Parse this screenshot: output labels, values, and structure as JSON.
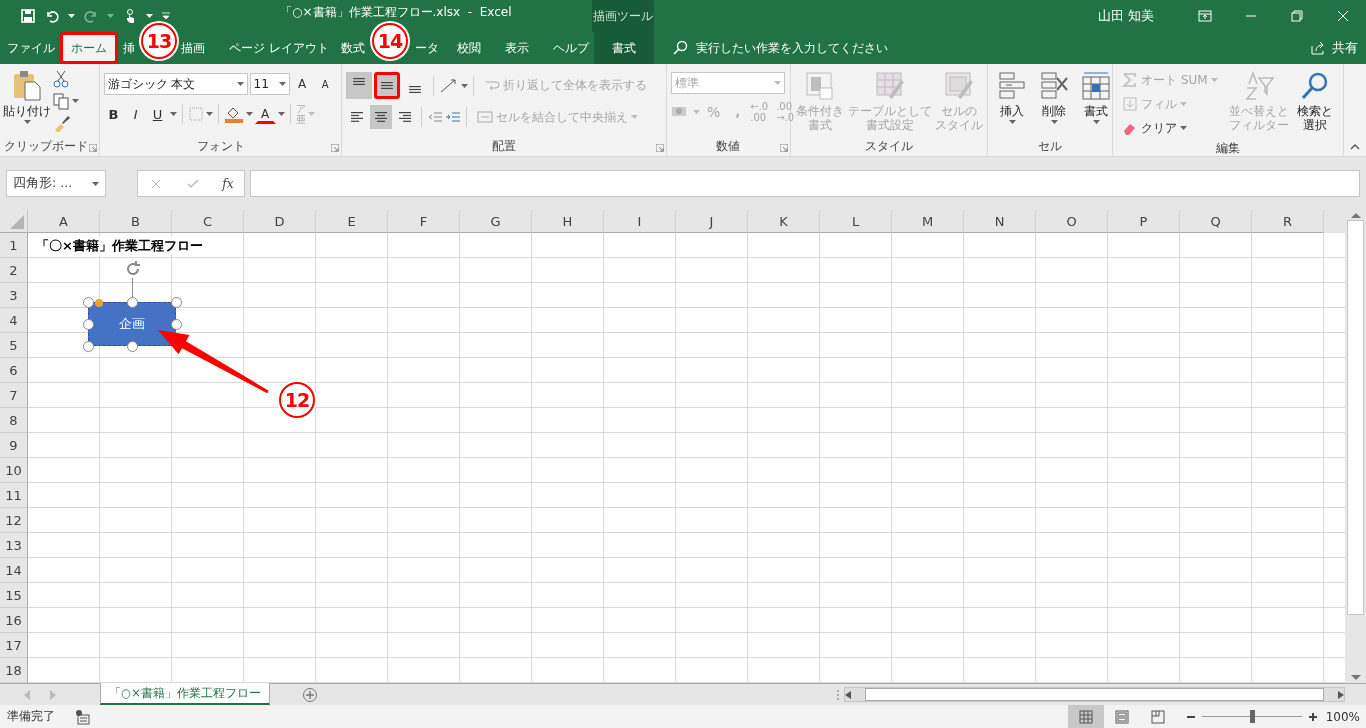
{
  "title_bar": {
    "title": "「○×書籍」作業工程フロー.xlsx  -  Excel",
    "context_group": "描画ツール",
    "user": "山田 知美"
  },
  "tabs": [
    {
      "label": "ファイル",
      "selected": false,
      "highlighted": false,
      "kind": "normal"
    },
    {
      "label": "ホーム",
      "selected": true,
      "highlighted": true,
      "kind": "normal"
    },
    {
      "label": "挿",
      "selected": false,
      "highlighted": false,
      "kind": "normal"
    },
    {
      "label": "描画",
      "selected": false,
      "highlighted": false,
      "kind": "normal"
    },
    {
      "label": "ページ レイアウト",
      "selected": false,
      "highlighted": false,
      "kind": "normal"
    },
    {
      "label": "数式",
      "selected": false,
      "highlighted": false,
      "kind": "normal"
    },
    {
      "label": "ータ",
      "selected": false,
      "highlighted": false,
      "kind": "normal"
    },
    {
      "label": "校閲",
      "selected": false,
      "highlighted": false,
      "kind": "normal"
    },
    {
      "label": "表示",
      "selected": false,
      "highlighted": false,
      "kind": "normal"
    },
    {
      "label": "ヘルプ",
      "selected": false,
      "highlighted": false,
      "kind": "normal"
    },
    {
      "label": "書式",
      "selected": false,
      "highlighted": false,
      "kind": "contextual"
    }
  ],
  "tell_me": {
    "placeholder": "実行したい作業を入力してください"
  },
  "share": "共有",
  "ribbon": {
    "clipboard": {
      "label": "クリップボード",
      "paste": "貼り付け"
    },
    "font": {
      "label": "フォント",
      "font_name": "游ゴシック 本文",
      "font_size": "11",
      "grow": "A",
      "shrink": "A",
      "styles": [
        "B",
        "I",
        "U"
      ],
      "fill": {
        "color": "#ed7d31"
      },
      "font_color": {
        "label": "A",
        "color": "#ff0000"
      },
      "phonetic": [
        "ア",
        "亜"
      ]
    },
    "alignment": {
      "label": "配置",
      "vertical": [
        {
          "kind": "top",
          "selected": true,
          "highlighted": false
        },
        {
          "kind": "middle",
          "selected": true,
          "highlighted": true
        },
        {
          "kind": "bottom",
          "selected": false,
          "highlighted": false
        }
      ],
      "horizontal": [
        {
          "kind": "left",
          "selected": false
        },
        {
          "kind": "center",
          "selected": true
        },
        {
          "kind": "right",
          "selected": false
        }
      ],
      "wrap": {
        "label": "折り返して全体を表示する",
        "disabled": true
      },
      "merge": {
        "label": "セルを結合して中央揃え",
        "disabled": true
      }
    },
    "number": {
      "label": "数値",
      "format": "標準",
      "percent": "%",
      "comma": ",",
      "increase_decimal": [
        "←.0",
        ".00"
      ],
      "decrease_decimal": [
        ".00",
        "→.0"
      ]
    },
    "styles": {
      "label": "スタイル",
      "buttons": [
        {
          "kind": "conditional",
          "lines": [
            "条件付き",
            "書式"
          ],
          "disabled": true
        },
        {
          "kind": "table",
          "lines": [
            "テーブルとして",
            "書式設定"
          ],
          "disabled": true
        },
        {
          "kind": "cellstyle",
          "lines": [
            "セルの",
            "スタイル"
          ],
          "disabled": true
        }
      ]
    },
    "cells": {
      "label": "セル",
      "buttons": [
        {
          "kind": "insert",
          "lines": [
            "挿入"
          ],
          "disabled": false
        },
        {
          "kind": "delete",
          "lines": [
            "削除"
          ],
          "disabled": false
        },
        {
          "kind": "format",
          "lines": [
            "書式"
          ],
          "disabled": false
        }
      ]
    },
    "editing": {
      "label": "編集",
      "small": [
        {
          "kind": "sum",
          "label": "オート SUM",
          "disabled": true
        },
        {
          "kind": "fill",
          "label": "フィル",
          "disabled": true
        },
        {
          "kind": "clear",
          "label": "クリア",
          "disabled": false
        }
      ],
      "buttons": [
        {
          "kind": "sort",
          "lines": [
            "並べ替えと",
            "フィルター"
          ],
          "disabled": true
        },
        {
          "kind": "find",
          "lines": [
            "検索と",
            "選択"
          ],
          "disabled": false
        }
      ]
    }
  },
  "formula_bar": {
    "name_box": "四角形: ...",
    "function_label": "fx"
  },
  "sheet": {
    "columns": [
      "A",
      "B",
      "C",
      "D",
      "E",
      "F",
      "G",
      "H",
      "I",
      "J",
      "K",
      "L",
      "M",
      "N",
      "O",
      "P",
      "Q",
      "R"
    ],
    "rows": [
      {
        "label": "1",
        "text": "「〇×書籍」作業工程フロー"
      },
      {
        "label": "2"
      },
      {
        "label": "3"
      },
      {
        "label": "4"
      },
      {
        "label": "5"
      },
      {
        "label": "6"
      },
      {
        "label": "7"
      },
      {
        "label": "8"
      },
      {
        "label": "9"
      },
      {
        "label": "10"
      },
      {
        "label": "11"
      },
      {
        "label": "12"
      },
      {
        "label": "13"
      },
      {
        "label": "14"
      },
      {
        "label": "15"
      },
      {
        "label": "16"
      },
      {
        "label": "17"
      },
      {
        "label": "18"
      }
    ]
  },
  "shape": {
    "text": "企画"
  },
  "sheet_tabs": [
    {
      "label": "「○×書籍」作業工程フロー",
      "selected": true
    }
  ],
  "status_bar": {
    "text": "準備完了",
    "views": [
      {
        "kind": "normal",
        "selected": true
      },
      {
        "kind": "page_layout",
        "selected": false
      },
      {
        "kind": "page_break",
        "selected": false
      }
    ],
    "zoom": {
      "level": 0.5,
      "reading": "100%"
    }
  },
  "callouts": [
    {
      "label": "12",
      "kind": "arrow"
    },
    {
      "label": "13",
      "kind": "plain"
    },
    {
      "label": "14",
      "kind": "plain"
    }
  ]
}
